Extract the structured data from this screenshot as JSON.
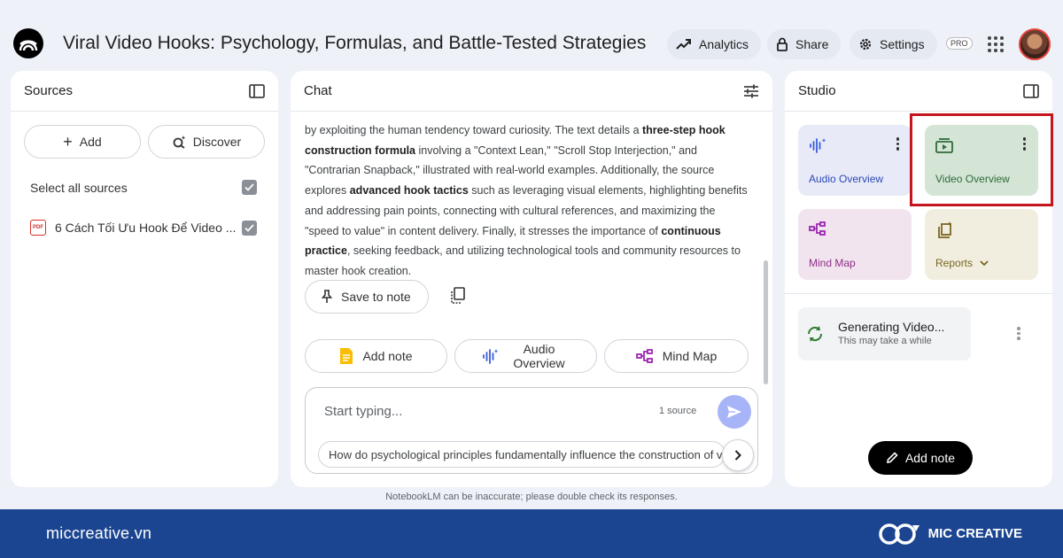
{
  "header": {
    "title": "Viral Video Hooks: Psychology, Formulas, and Battle-Tested Strategies",
    "analytics_label": "Analytics",
    "share_label": "Share",
    "settings_label": "Settings",
    "pro_badge": "PRO"
  },
  "sources": {
    "title": "Sources",
    "add_label": "Add",
    "discover_label": "Discover",
    "select_all_label": "Select all sources",
    "items": [
      {
        "title": "6 Cách Tối Ưu Hook Để Video ...",
        "type_badge": "PDF",
        "checked": true
      }
    ]
  },
  "chat": {
    "title": "Chat",
    "message_parts": [
      "by exploiting the human tendency toward curiosity. The text details a ",
      "three-step hook construction formula",
      " involving a \"Context Lean,\" \"Scroll Stop Interjection,\" and \"Contrarian Snapback,\" illustrated with real-world examples. Additionally, the source explores ",
      "advanced hook tactics",
      " such as leveraging visual elements, highlighting benefits and addressing pain points, connecting with cultural references, and maximizing the \"speed to value\" in content delivery. Finally, it stresses the importance of ",
      "continuous practice",
      ", seeking feedback, and utilizing technological tools and community resources to master hook creation."
    ],
    "save_to_note_label": "Save to note",
    "actions": {
      "add_note": "Add note",
      "audio_overview": "Audio Overview",
      "mind_map": "Mind Map"
    },
    "input_placeholder": "Start typing...",
    "source_count": "1 source",
    "suggestion": "How do psychological principles fundamentally influence the construction of viral video hooks?"
  },
  "studio": {
    "title": "Studio",
    "tiles": {
      "audio_overview": "Audio Overview",
      "video_overview": "Video Overview",
      "mind_map": "Mind Map",
      "reports": "Reports"
    },
    "generating_title": "Generating Video...",
    "generating_subtitle": "This may take a while",
    "add_note_label": "Add note"
  },
  "disclaimer": "NotebookLM can be inaccurate; please double check its responses.",
  "footer": {
    "url": "miccreative.vn",
    "brand": "MIC CREATIVE"
  },
  "colors": {
    "audio_tile": "#e8ebf7",
    "video_tile": "#d4e5d6",
    "mind_map_tile": "#f1e4ee",
    "reports_tile": "#f1eee0",
    "highlight_border": "#c4161c",
    "footer_bg": "#1c4591"
  }
}
